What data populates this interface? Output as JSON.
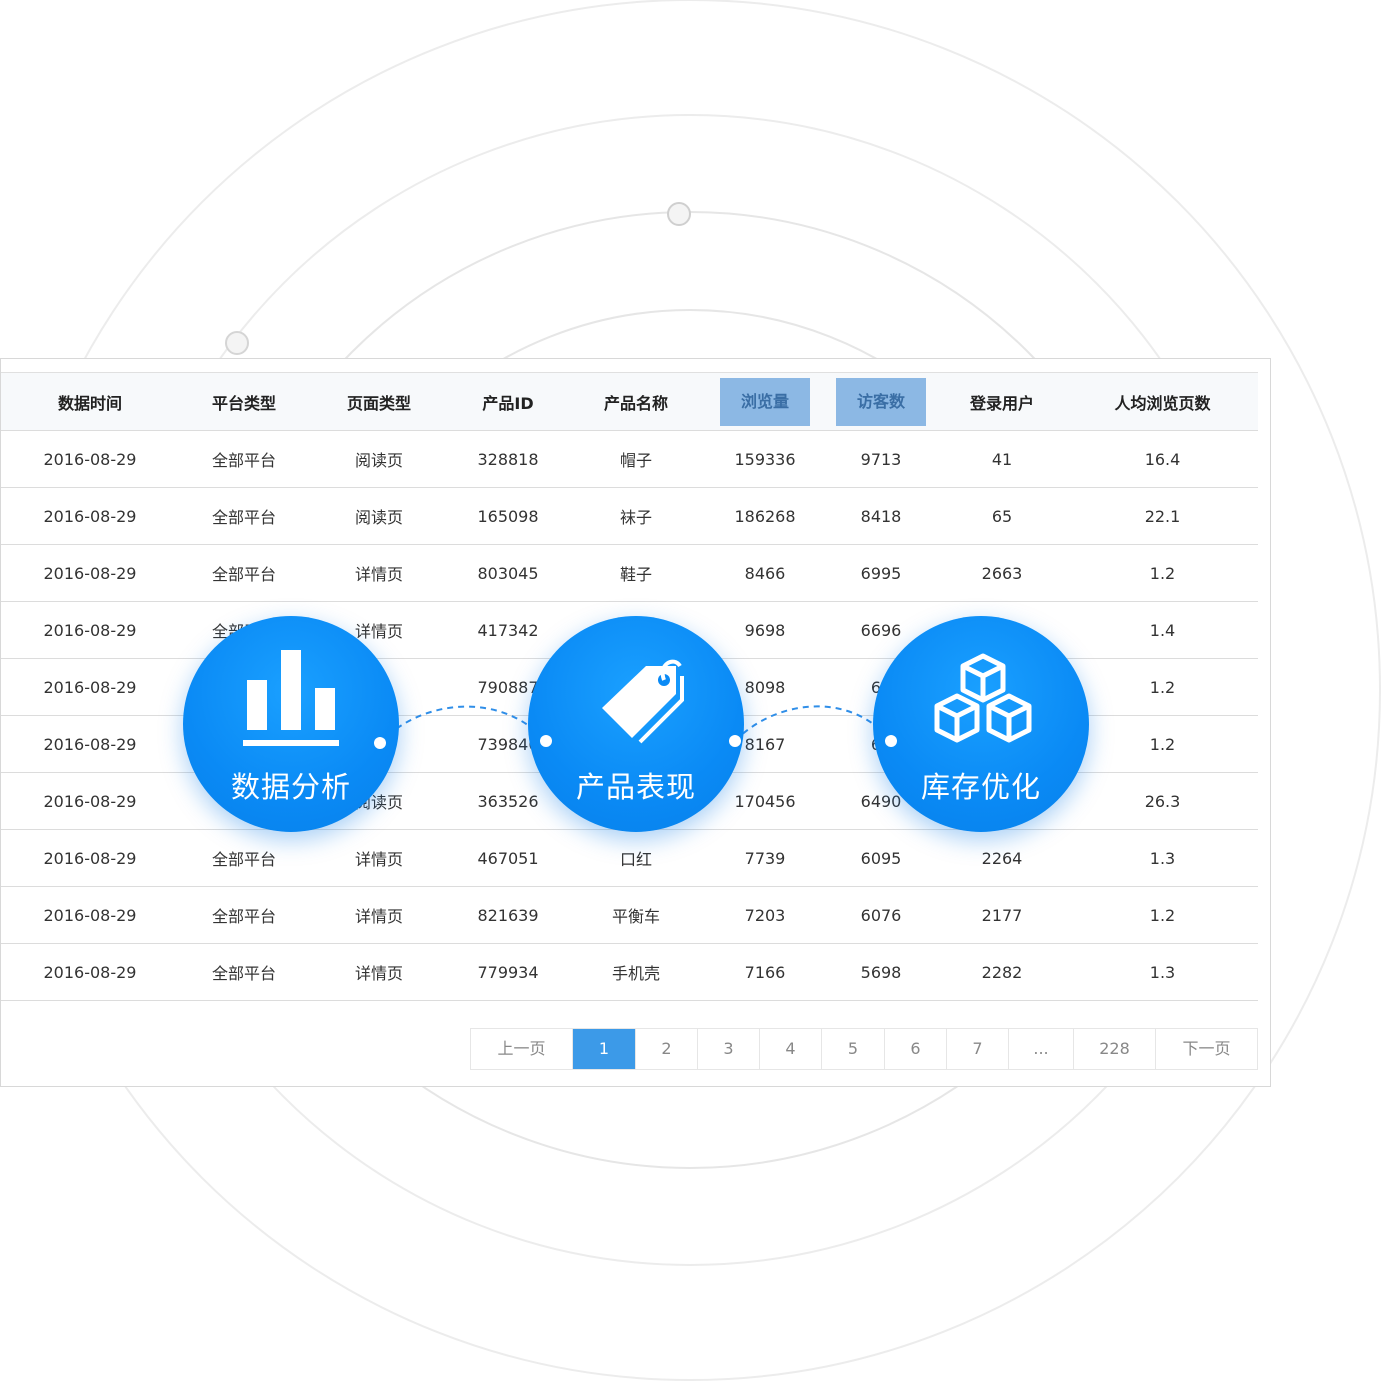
{
  "table": {
    "columns": [
      "数据时间",
      "平台类型",
      "页面类型",
      "产品ID",
      "产品名称",
      "浏览量",
      "访客数",
      "登录用户",
      "人均浏览页数"
    ],
    "highlighted_columns": [
      "浏览量",
      "访客数"
    ],
    "rows": [
      [
        "2016-08-29",
        "全部平台",
        "阅读页",
        "328818",
        "帽子",
        "159336",
        "9713",
        "41",
        "16.4"
      ],
      [
        "2016-08-29",
        "全部平台",
        "阅读页",
        "165098",
        "袜子",
        "186268",
        "8418",
        "65",
        "22.1"
      ],
      [
        "2016-08-29",
        "全部平台",
        "详情页",
        "803045",
        "鞋子",
        "8466",
        "6995",
        "2663",
        "1.2"
      ],
      [
        "2016-08-29",
        "全部平台",
        "详情页",
        "417342",
        "",
        "9698",
        "6696",
        "",
        "1.4"
      ],
      [
        "2016-08-29",
        "",
        "页",
        "790887",
        "",
        "8098",
        "66",
        "",
        "1.2"
      ],
      [
        "2016-08-29",
        "",
        "页",
        "739840",
        "",
        "8167",
        "65",
        "",
        "1.2"
      ],
      [
        "2016-08-29",
        "",
        "阅读页",
        "363526",
        "",
        "170456",
        "6490",
        "",
        "26.3"
      ],
      [
        "2016-08-29",
        "全部平台",
        "详情页",
        "467051",
        "口红",
        "7739",
        "6095",
        "2264",
        "1.3"
      ],
      [
        "2016-08-29",
        "全部平台",
        "详情页",
        "821639",
        "平衡车",
        "7203",
        "6076",
        "2177",
        "1.2"
      ],
      [
        "2016-08-29",
        "全部平台",
        "详情页",
        "779934",
        "手机壳",
        "7166",
        "5698",
        "2282",
        "1.3"
      ]
    ]
  },
  "pagination": {
    "prev_label": "上一页",
    "next_label": "下一页",
    "pages": [
      "1",
      "2",
      "3",
      "4",
      "5",
      "6",
      "7",
      "...",
      "228"
    ],
    "active_page": "1"
  },
  "features": [
    {
      "label": "数据分析",
      "icon": "bar-chart-icon"
    },
    {
      "label": "产品表现",
      "icon": "price-tag-icon"
    },
    {
      "label": "库存优化",
      "icon": "boxes-icon"
    }
  ],
  "colors": {
    "feature_blue": "#0a8af5",
    "active_page": "#3c9ae8",
    "highlight_header": "#8cb8e4",
    "connector": "#2f8ee8"
  }
}
